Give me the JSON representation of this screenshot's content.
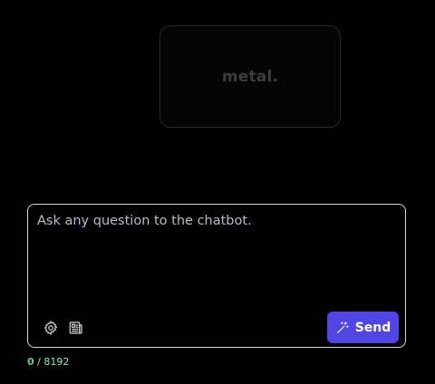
{
  "logo": {
    "text": "metal."
  },
  "composer": {
    "placeholder": "Ask any question to the chatbot.",
    "value": "",
    "send_label": "Send",
    "send_icon": "magic-wand-icon",
    "tools": [
      {
        "name": "settings",
        "icon": "gear-icon"
      },
      {
        "name": "documents",
        "icon": "newspaper-icon"
      }
    ]
  },
  "counter": {
    "current": "0",
    "separator": " / ",
    "max": "8192"
  },
  "colors": {
    "background": "#000000",
    "accent": "#4f46e5",
    "counter": "#86efac"
  }
}
